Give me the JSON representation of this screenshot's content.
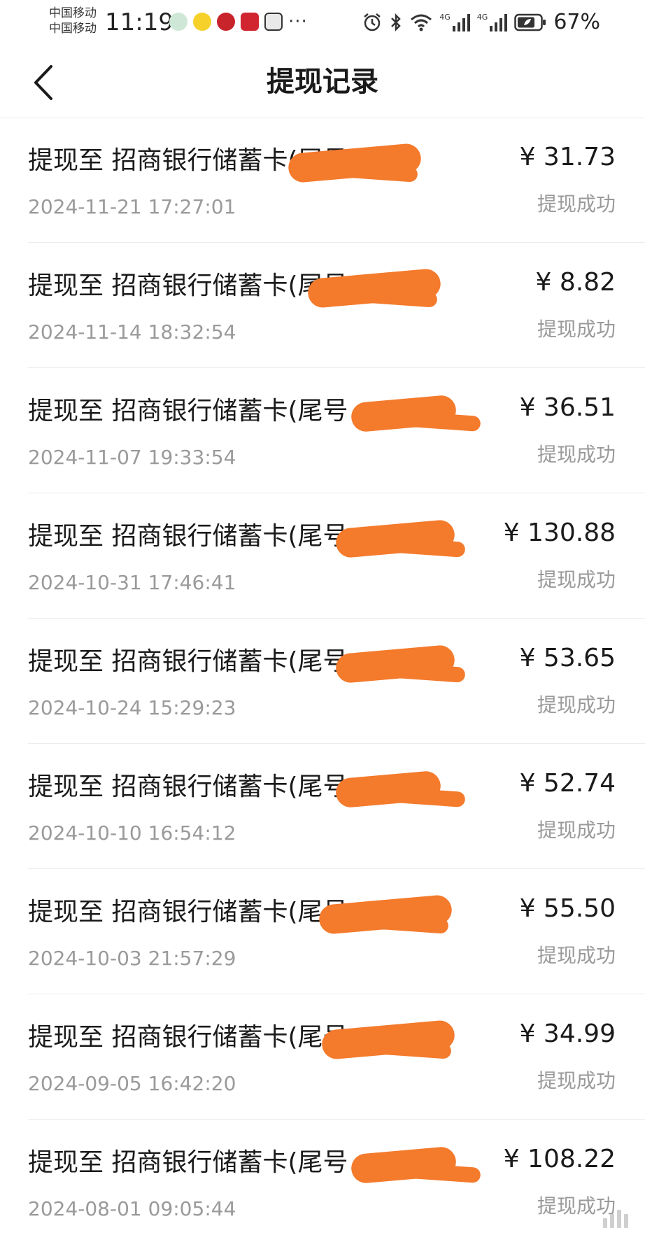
{
  "status_bar": {
    "carrier_1": "中国移动",
    "carrier_2": "中国移动",
    "time": "11:19",
    "more": "···",
    "network_1": "4G",
    "network_2": "4G",
    "battery": "67%"
  },
  "header": {
    "title": "提现记录"
  },
  "records": [
    {
      "title": "提现至 招商银行储蓄卡(尾号",
      "amount": "¥ 31.73",
      "time": "2024-11-21 17:27:01",
      "status": "提现成功"
    },
    {
      "title": "提现至 招商银行储蓄卡(尾号",
      "amount": "¥ 8.82",
      "time": "2024-11-14 18:32:54",
      "status": "提现成功"
    },
    {
      "title": "提现至 招商银行储蓄卡(尾号",
      "amount": "¥ 36.51",
      "time": "2024-11-07 19:33:54",
      "status": "提现成功"
    },
    {
      "title": "提现至 招商银行储蓄卡(尾号",
      "amount": "¥ 130.88",
      "time": "2024-10-31 17:46:41",
      "status": "提现成功"
    },
    {
      "title": "提现至 招商银行储蓄卡(尾号",
      "amount": "¥ 53.65",
      "time": "2024-10-24 15:29:23",
      "status": "提现成功"
    },
    {
      "title": "提现至 招商银行储蓄卡(尾号",
      "amount": "¥ 52.74",
      "time": "2024-10-10 16:54:12",
      "status": "提现成功"
    },
    {
      "title": "提现至 招商银行储蓄卡(尾号",
      "amount": "¥ 55.50",
      "time": "2024-10-03 21:57:29",
      "status": "提现成功"
    },
    {
      "title": "提现至 招商银行储蓄卡(尾号",
      "amount": "¥ 34.99",
      "time": "2024-09-05 16:42:20",
      "status": "提现成功"
    },
    {
      "title": "提现至 招商银行储蓄卡(尾号",
      "amount": "¥ 108.22",
      "time": "2024-08-01 09:05:44",
      "status": "提现成功"
    }
  ],
  "colors": {
    "redaction": "#f47a2c",
    "secondary_text": "#9a9a9a"
  }
}
